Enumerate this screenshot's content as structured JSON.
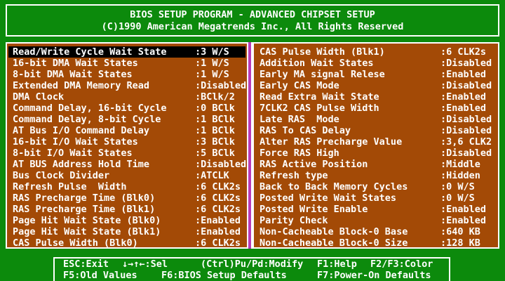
{
  "header": {
    "title": "BIOS SETUP PROGRAM - ADVANCED CHIPSET SETUP",
    "copyright": "(C)1990 American Megatrends Inc., All Rights Reserved"
  },
  "left": [
    {
      "label": "Read/Write Cycle Wait State",
      "sep": ":",
      "value": "3 W/S"
    },
    {
      "label": "16-bit DMA Wait States",
      "sep": ":",
      "value": "1 W/S"
    },
    {
      "label": "8-bit DMA Wait States",
      "sep": ":",
      "value": "1 W/S"
    },
    {
      "label": "Extended DMA Memory Read",
      "sep": ":",
      "value": "Disabled"
    },
    {
      "label": "DMA Clock",
      "sep": ":",
      "value": "BClk/2"
    },
    {
      "label": "Command Delay, 16-bit Cycle",
      "sep": ":",
      "value": "0 BClk"
    },
    {
      "label": "Command Delay, 8-bit Cycle",
      "sep": ":",
      "value": "1 BClk"
    },
    {
      "label": "AT Bus I/O Command Delay",
      "sep": ":",
      "value": "1 BClk"
    },
    {
      "label": "16-bit I/O Wait States",
      "sep": ":",
      "value": "3 BClk"
    },
    {
      "label": "8-bit I/O Wait States",
      "sep": ":",
      "value": "5 BClk"
    },
    {
      "label": "AT BUS Address Hold Time",
      "sep": ":",
      "value": "Disabled"
    },
    {
      "label": "Bus Clock Divider",
      "sep": ":",
      "value": "ATCLK"
    },
    {
      "label": "Refresh Pulse  Width",
      "sep": ":",
      "value": "6 CLK2s"
    },
    {
      "label": "RAS Precharge Time (Blk0)",
      "sep": ":",
      "value": "6 CLK2s"
    },
    {
      "label": "RAS Precharge Time (Blk1)",
      "sep": ":",
      "value": "6 CLK2s"
    },
    {
      "label": "Page Hit Wait State (Blk0)",
      "sep": ":",
      "value": "Enabled"
    },
    {
      "label": "Page Hit Wait State (Blk1)",
      "sep": ":",
      "value": "Enabled"
    },
    {
      "label": "CAS Pulse Width (Blk0)",
      "sep": ":",
      "value": "6 CLK2s"
    }
  ],
  "right": [
    {
      "label": "CAS Pulse Width (Blk1)",
      "sep": ":",
      "value": "6 CLK2s"
    },
    {
      "label": "Addition Wait States",
      "sep": ":",
      "value": "Disabled"
    },
    {
      "label": "Early MA signal Relese",
      "sep": ":",
      "value": "Enabled"
    },
    {
      "label": "Early CAS Mode",
      "sep": ":",
      "value": "Disabled"
    },
    {
      "label": "Read Extra Wait State",
      "sep": ":",
      "value": "Enabled"
    },
    {
      "label": "7CLK2 CAS Pulse Width",
      "sep": ":",
      "value": "Enabled"
    },
    {
      "label": "Late RAS  Mode",
      "sep": ":",
      "value": "Disabled"
    },
    {
      "label": "RAS To CAS Delay",
      "sep": ":",
      "value": "Disabled"
    },
    {
      "label": "Alter RAS Precharge Value",
      "sep": ":",
      "value": "3,6 CLK2"
    },
    {
      "label": "Force RAS High",
      "sep": ":",
      "value": "Disabled"
    },
    {
      "label": "RAS Active Position",
      "sep": ":",
      "value": "Middle"
    },
    {
      "label": "Refresh type",
      "sep": ":",
      "value": "Hidden"
    },
    {
      "label": "Back to Back Memory Cycles",
      "sep": ":",
      "value": "0 W/S"
    },
    {
      "label": "Posted Write Wait States",
      "sep": ":",
      "value": "0 W/S"
    },
    {
      "label": "Posted Write Enable",
      "sep": ":",
      "value": "Enabled"
    },
    {
      "label": "Parity Check",
      "sep": ":",
      "value": "Enabled"
    },
    {
      "label": "Non-Cacheable Block-0 Base",
      "sep": ":",
      "value": "640 KB"
    },
    {
      "label": "Non-Cacheable Block-0 Size",
      "sep": ":",
      "value": "128 KB"
    }
  ],
  "selected_index": 0,
  "footer": {
    "line1": {
      "esc": "ESC:Exit",
      "sel": "↓→↑←:Sel",
      "modify": "(Ctrl)Pu/Pd:Modify",
      "help": "F1:Help",
      "color": "F2/F3:Color"
    },
    "line2": {
      "old": "F5:Old Values",
      "bios": "F6:BIOS Setup Defaults",
      "power": "F7:Power-On Defaults"
    }
  },
  "colors": {
    "background": "#0c8a0c",
    "panel": "#a34a06",
    "divider": "#b83ab8",
    "selection": "#000000",
    "text": "#ffffff"
  }
}
